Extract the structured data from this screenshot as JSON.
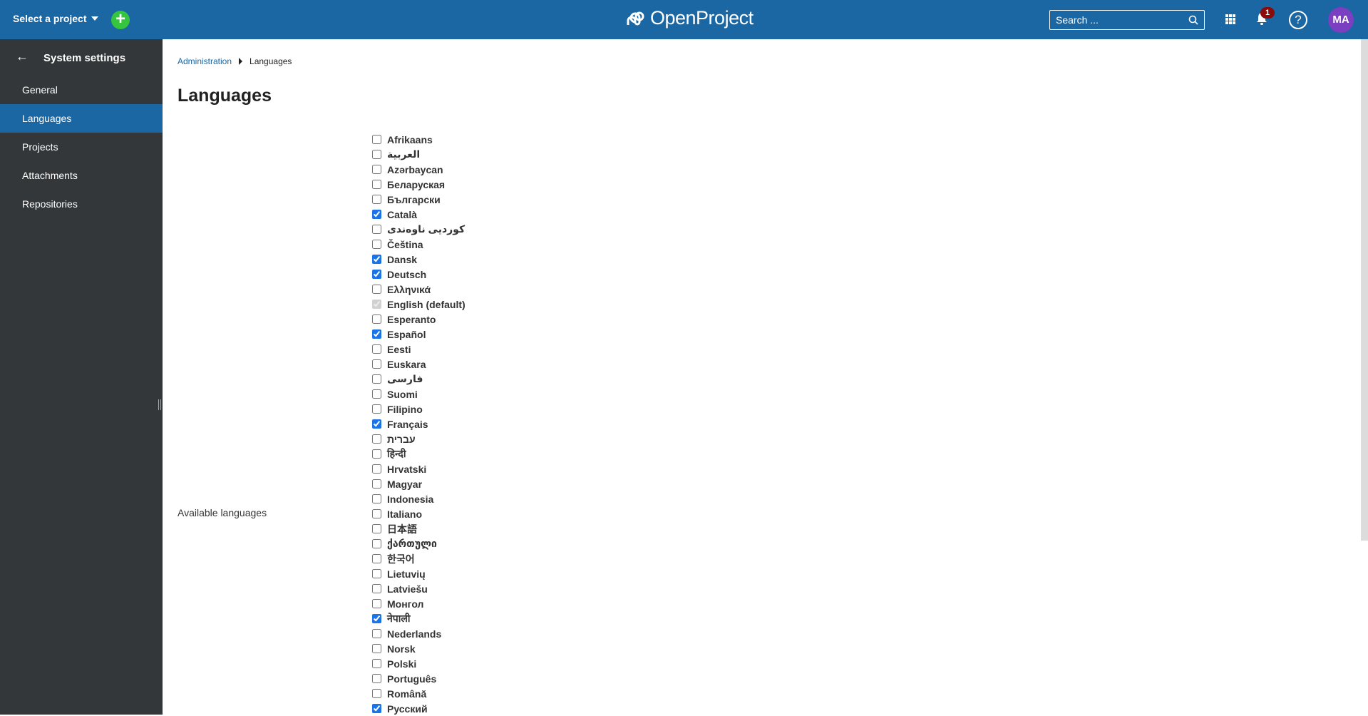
{
  "header": {
    "project_select": "Select a project",
    "logo_text": "OpenProject",
    "search_placeholder": "Search ...",
    "notification_count": "1",
    "help_label": "?",
    "avatar_initials": "MA"
  },
  "sidebar": {
    "title": "System settings",
    "items": [
      {
        "label": "General",
        "active": false
      },
      {
        "label": "Languages",
        "active": true
      },
      {
        "label": "Projects",
        "active": false
      },
      {
        "label": "Attachments",
        "active": false
      },
      {
        "label": "Repositories",
        "active": false
      }
    ]
  },
  "breadcrumb": {
    "parent": "Administration",
    "current": "Languages"
  },
  "page_title": "Languages",
  "field_label": "Available languages",
  "languages": [
    {
      "label": "Afrikaans",
      "checked": false,
      "disabled": false
    },
    {
      "label": "العربية",
      "checked": false,
      "disabled": false
    },
    {
      "label": "Azərbaycan",
      "checked": false,
      "disabled": false
    },
    {
      "label": "Беларуская",
      "checked": false,
      "disabled": false
    },
    {
      "label": "Български",
      "checked": false,
      "disabled": false
    },
    {
      "label": "Català",
      "checked": true,
      "disabled": false
    },
    {
      "label": "کوردیی ناوەندی",
      "checked": false,
      "disabled": false
    },
    {
      "label": "Čeština",
      "checked": false,
      "disabled": false
    },
    {
      "label": "Dansk",
      "checked": true,
      "disabled": false
    },
    {
      "label": "Deutsch",
      "checked": true,
      "disabled": false
    },
    {
      "label": "Ελληνικά",
      "checked": false,
      "disabled": false
    },
    {
      "label": "English (default)",
      "checked": true,
      "disabled": true
    },
    {
      "label": "Esperanto",
      "checked": false,
      "disabled": false
    },
    {
      "label": "Español",
      "checked": true,
      "disabled": false
    },
    {
      "label": "Eesti",
      "checked": false,
      "disabled": false
    },
    {
      "label": "Euskara",
      "checked": false,
      "disabled": false
    },
    {
      "label": "فارسی",
      "checked": false,
      "disabled": false
    },
    {
      "label": "Suomi",
      "checked": false,
      "disabled": false
    },
    {
      "label": "Filipino",
      "checked": false,
      "disabled": false
    },
    {
      "label": "Français",
      "checked": true,
      "disabled": false
    },
    {
      "label": "עברית",
      "checked": false,
      "disabled": false
    },
    {
      "label": "हिन्दी",
      "checked": false,
      "disabled": false
    },
    {
      "label": "Hrvatski",
      "checked": false,
      "disabled": false
    },
    {
      "label": "Magyar",
      "checked": false,
      "disabled": false
    },
    {
      "label": "Indonesia",
      "checked": false,
      "disabled": false
    },
    {
      "label": "Italiano",
      "checked": false,
      "disabled": false
    },
    {
      "label": "日本語",
      "checked": false,
      "disabled": false
    },
    {
      "label": "ქართული",
      "checked": false,
      "disabled": false
    },
    {
      "label": "한국어",
      "checked": false,
      "disabled": false
    },
    {
      "label": "Lietuvių",
      "checked": false,
      "disabled": false
    },
    {
      "label": "Latviešu",
      "checked": false,
      "disabled": false
    },
    {
      "label": "Монгол",
      "checked": false,
      "disabled": false
    },
    {
      "label": "नेपाली",
      "checked": true,
      "disabled": false
    },
    {
      "label": "Nederlands",
      "checked": false,
      "disabled": false
    },
    {
      "label": "Norsk",
      "checked": false,
      "disabled": false
    },
    {
      "label": "Polski",
      "checked": false,
      "disabled": false
    },
    {
      "label": "Português",
      "checked": false,
      "disabled": false
    },
    {
      "label": "Română",
      "checked": false,
      "disabled": false
    },
    {
      "label": "Русский",
      "checked": true,
      "disabled": false
    }
  ],
  "colors": {
    "header_bg": "#1a67a3",
    "sidebar_bg": "#333739",
    "active_item": "#1a67a3",
    "add_button": "#35c53f",
    "avatar": "#7b3fc1",
    "badge": "#8b0a0a"
  }
}
